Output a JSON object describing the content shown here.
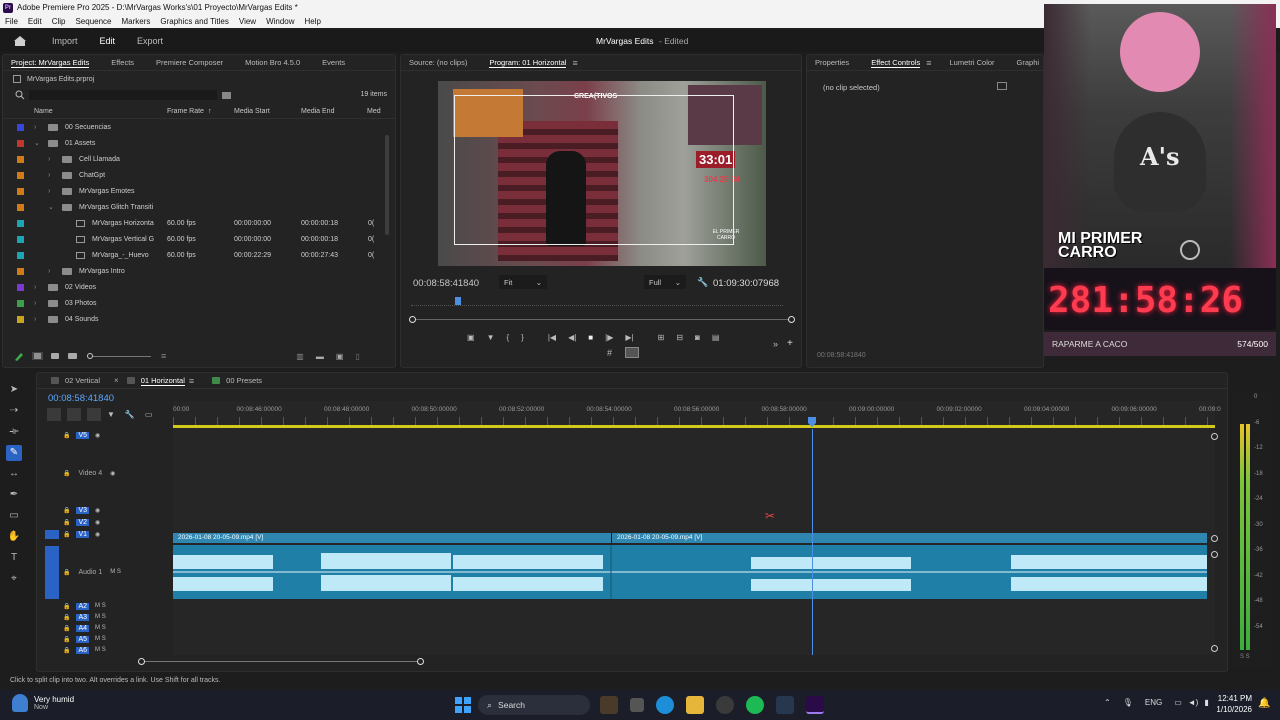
{
  "app": {
    "title": "Adobe Premiere Pro 2025 - D:\\MrVargas Works's\\01 Proyecto\\MrVargas Edits *",
    "logo": "Pr"
  },
  "menu": [
    "File",
    "Edit",
    "Clip",
    "Sequence",
    "Markers",
    "Graphics and Titles",
    "View",
    "Window",
    "Help"
  ],
  "workspace": {
    "items": [
      "Import",
      "Edit",
      "Export"
    ],
    "active": "Edit",
    "doc_title": "MrVargas Edits",
    "doc_status": "- Edited"
  },
  "project_panel": {
    "tabs": [
      "Project: MrVargas Edits",
      "Effects",
      "Premiere Composer",
      "Motion Bro 4.5.0",
      "Events"
    ],
    "file": "MrVargas Edits.prproj",
    "item_count": "19 items",
    "columns": [
      "Name",
      "Frame Rate",
      "Media Start",
      "Media End",
      "Med"
    ],
    "rows": [
      {
        "indent": 0,
        "kind": "folder",
        "arrow": "›",
        "name": "00 Secuencias",
        "color": "#3a46d9",
        "fps": "",
        "start": "",
        "end": "",
        "extra": ""
      },
      {
        "indent": 0,
        "kind": "folder",
        "arrow": "⌄",
        "name": "01 Assets",
        "color": "#c0372f",
        "fps": "",
        "start": "",
        "end": "",
        "extra": ""
      },
      {
        "indent": 1,
        "kind": "folder",
        "arrow": "›",
        "name": "Cell Llamada",
        "color": "#d07a1b",
        "fps": "",
        "start": "",
        "end": "",
        "extra": ""
      },
      {
        "indent": 1,
        "kind": "folder",
        "arrow": "›",
        "name": "ChatGpt",
        "color": "#d07a1b",
        "fps": "",
        "start": "",
        "end": "",
        "extra": ""
      },
      {
        "indent": 1,
        "kind": "folder",
        "arrow": "›",
        "name": "MrVargas Emotes",
        "color": "#d07a1b",
        "fps": "",
        "start": "",
        "end": "",
        "extra": ""
      },
      {
        "indent": 1,
        "kind": "folder",
        "arrow": "⌄",
        "name": "MrVargas Glitch Transiti",
        "color": "#d07a1b",
        "fps": "",
        "start": "",
        "end": "",
        "extra": ""
      },
      {
        "indent": 2,
        "kind": "clip",
        "arrow": "",
        "name": "MrVargas Horizonta",
        "color": "#1fa4b5",
        "fps": "60.00 fps",
        "start": "00:00:00:00",
        "end": "00:00:00:18",
        "extra": "0("
      },
      {
        "indent": 2,
        "kind": "clip",
        "arrow": "",
        "name": "MrVargas Vertical G",
        "color": "#1fa4b5",
        "fps": "60.00 fps",
        "start": "00:00:00:00",
        "end": "00:00:00:18",
        "extra": "0("
      },
      {
        "indent": 2,
        "kind": "clip",
        "arrow": "",
        "name": "MrVarga_-_Huevo",
        "color": "#1fa4b5",
        "fps": "60.00 fps",
        "start": "00:00:22:29",
        "end": "00:00:27:43",
        "extra": "0("
      },
      {
        "indent": 1,
        "kind": "folder",
        "arrow": "›",
        "name": "MrVargas Intro",
        "color": "#d07a1b",
        "fps": "",
        "start": "",
        "end": "",
        "extra": ""
      },
      {
        "indent": 0,
        "kind": "folder",
        "arrow": "›",
        "name": "02 Videos",
        "color": "#7a3ad0",
        "fps": "",
        "start": "",
        "end": "",
        "extra": ""
      },
      {
        "indent": 0,
        "kind": "folder",
        "arrow": "›",
        "name": "03 Photos",
        "color": "#3aa04a",
        "fps": "",
        "start": "",
        "end": "",
        "extra": ""
      },
      {
        "indent": 0,
        "kind": "folder",
        "arrow": "›",
        "name": "04 Sounds",
        "color": "#c6a51f",
        "fps": "",
        "start": "",
        "end": "",
        "extra": ""
      }
    ]
  },
  "program_monitor": {
    "tabs": [
      "Source: (no clips)",
      "Program: 01 Horizontal"
    ],
    "timecode": "00:08:58:41840",
    "fit": "Fit",
    "quality": "Full",
    "duration": "01:09:30:07968",
    "overlay": {
      "brand": "CREA(TIVOS",
      "timer": "33:01",
      "count": "304 25 34",
      "badge": "EL PRIMER CARRO"
    }
  },
  "effect_controls": {
    "tabs": [
      "Properties",
      "Effect Controls",
      "Lumetri Color",
      "Graphi"
    ],
    "message": "(no clip selected)",
    "timecode": "00:08:58:41840"
  },
  "webcam": {
    "hat_text": "A's",
    "banner": "MI PRIMER CARRO",
    "timer": "281:58:26",
    "goal_label": "RAPARME A CACO",
    "goal_count": "574/500"
  },
  "timeline": {
    "tabs": [
      "02 Vertical",
      "01 Horizontal",
      "00 Presets"
    ],
    "timecode": "00:08:58:41840",
    "ruler": [
      "00:00",
      "00:08:46:00000",
      "00:08:48:00000",
      "00:08:50:00000",
      "00:08:52:00000",
      "00:08:54:00000",
      "00:08:56:00000",
      "00:08:58:00000",
      "00:09:00:00000",
      "00:09:02:00000",
      "00:09:04:00000",
      "00:09:06:00000",
      "00:09:0"
    ],
    "video_tracks": [
      "V5",
      "Video 4",
      "V3",
      "V2",
      "V1"
    ],
    "audio_tracks": [
      "Audio 1",
      "A2",
      "A3",
      "A4",
      "A5",
      "A6"
    ],
    "clip1": "2026-01-08 20-05-09.mp4 [V]",
    "clip2": "2026-01-08 20-05-09.mp4 [V]",
    "meter_db": [
      "0",
      "-6",
      "-12",
      "-18",
      "-24",
      "-30",
      "-36",
      "-42",
      "-48",
      "-54"
    ],
    "meter_footer": "S S"
  },
  "status": "Click to split clip into two. Alt overrides a link. Use Shift for all tracks.",
  "taskbar": {
    "weather_title": "Very humid",
    "weather_sub": "Now",
    "search": "Search",
    "lang": "ENG",
    "time": "12:41 PM",
    "date": "1/10/2026"
  }
}
